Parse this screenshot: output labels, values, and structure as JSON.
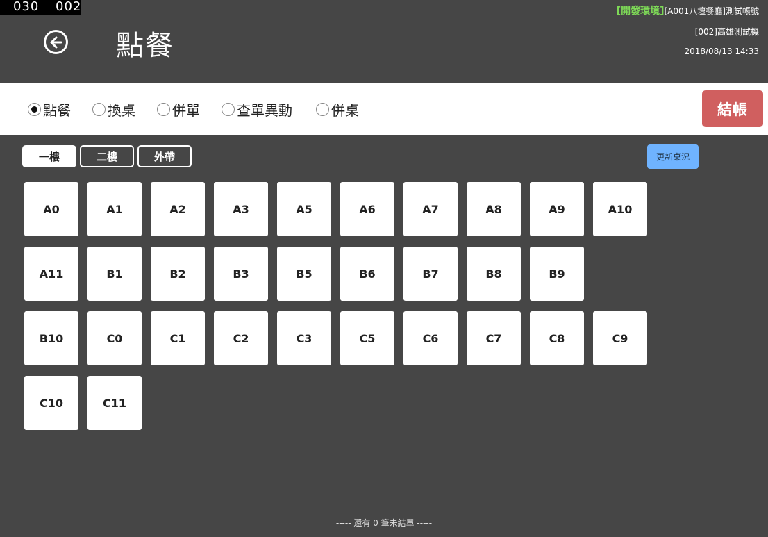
{
  "counters": {
    "left": "030",
    "right": "002"
  },
  "header": {
    "title": "點餐",
    "env_tag": "[開發環境]",
    "account": "[A001八壇餐廳]測試帳號",
    "device": "[002]高雄測試機",
    "datetime": "2018/08/13 14:33"
  },
  "modes": [
    {
      "label": "點餐",
      "checked": true
    },
    {
      "label": "換桌",
      "checked": false
    },
    {
      "label": "併單",
      "checked": false
    },
    {
      "label": "查單異動",
      "checked": false
    },
    {
      "label": "併桌",
      "checked": false
    }
  ],
  "checkout_label": "結帳",
  "floors": [
    {
      "label": "一樓",
      "active": true
    },
    {
      "label": "二樓",
      "active": false
    },
    {
      "label": "外帶",
      "active": false
    }
  ],
  "refresh_label": "更新桌況",
  "tables": [
    [
      "A0",
      "A1",
      "A2",
      "A3",
      "A5",
      "A6",
      "A7",
      "A8",
      "A9",
      "A10"
    ],
    [
      "A11",
      "B1",
      "B2",
      "B3",
      "B5",
      "B6",
      "B7",
      "B8",
      "B9"
    ],
    [
      "B10",
      "C0",
      "C1",
      "C2",
      "C3",
      "C5",
      "C6",
      "C7",
      "C8",
      "C9"
    ],
    [
      "C10",
      "C11"
    ]
  ],
  "footer_note": "----- 還有 0 筆未結單 -----",
  "colors": {
    "background": "#464646",
    "checkout": "#d05f5f",
    "refresh": "#6fb3ff",
    "env_tag": "#7ed957"
  }
}
